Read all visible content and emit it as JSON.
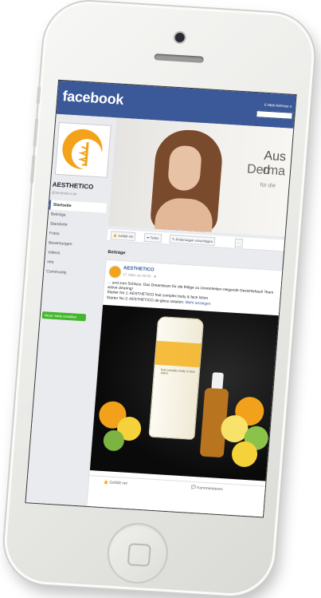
{
  "header": {
    "logo": "facebook",
    "email_label": "E-Mail-Adresse o"
  },
  "page": {
    "name": "AESTHETICO",
    "handle": "@aesthetico.de",
    "nav": [
      "Startseite",
      "Beiträge",
      "Standorte",
      "Fotos",
      "Bewertungen",
      "Videos",
      "Info",
      "Community"
    ],
    "create_button": "Neue Seite erstellen"
  },
  "cover": {
    "line1": "Aus d",
    "line2": "Derma",
    "line3": "für die"
  },
  "actions": {
    "like": "Gefällt mir",
    "share": "Teilen",
    "suggest": "Änderungen vorschlagen",
    "more": "···"
  },
  "posts": {
    "section_label": "Beiträge",
    "author": "AESTHETICO",
    "time": "27. März um 05:00 · ⊕",
    "text": "... und zum Schluss: Das Dreamteam für die fettige zu Unreinheiten neigende Gesichtshaut! Team active clearing!",
    "line2": "Starter No 1: AESTHETICO fruit complex body & face lotion",
    "line3": "Starter No 2: AESTHETICO de-gloss solution.",
    "more_link": "Mehr anzeigen",
    "image_text": "fruit complex body & face lotion",
    "like": "Gefällt mir",
    "comment": "Kommentieren"
  }
}
